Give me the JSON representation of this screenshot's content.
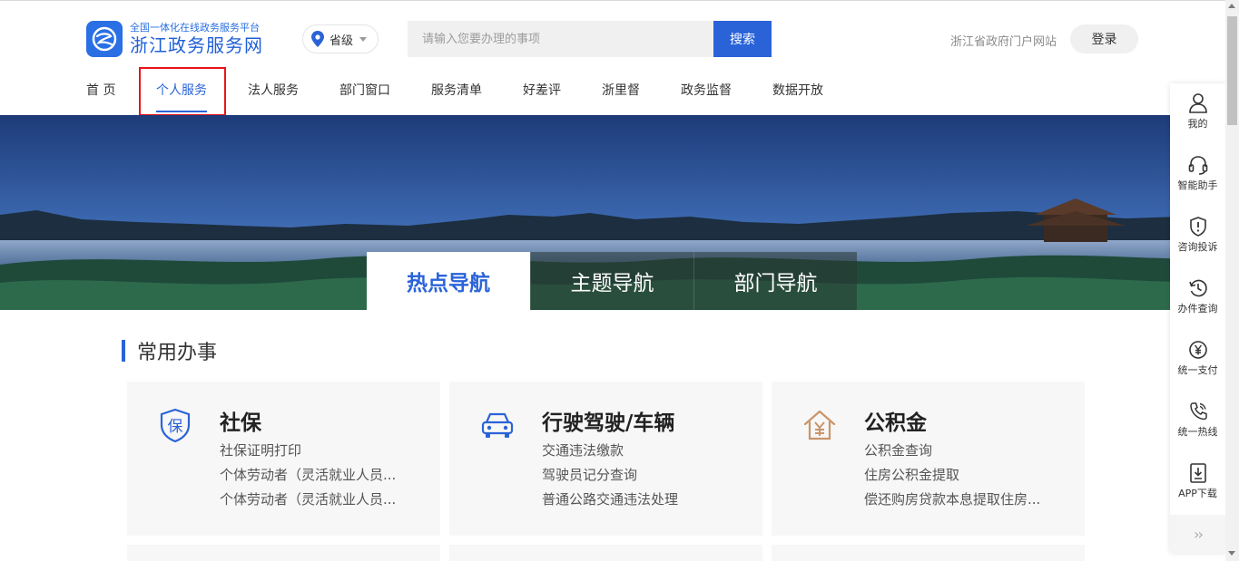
{
  "header": {
    "logo_subtitle": "全国一体化在线政务服务平台",
    "logo_title": "浙江政务服务网",
    "region_label": "省级",
    "search_placeholder": "请输入您要办理的事项",
    "search_button": "搜索",
    "gov_portal_link": "浙江省政府门户网站",
    "login_button": "登录"
  },
  "nav": {
    "items": [
      "首 页",
      "个人服务",
      "法人服务",
      "部门窗口",
      "服务清单",
      "好差评",
      "浙里督",
      "政务监督",
      "数据开放"
    ],
    "active": "个人服务"
  },
  "banner": {
    "tabs": [
      "热点导航",
      "主题导航",
      "部门导航"
    ],
    "active_tab": "热点导航"
  },
  "section": {
    "title": "常用办事"
  },
  "cards": [
    {
      "icon": "shield-bao-icon",
      "title": "社保",
      "links": [
        "社保证明打印",
        "个体劳动者（灵活就业人员...",
        "个体劳动者（灵活就业人员..."
      ]
    },
    {
      "icon": "car-icon",
      "title": "行驶驾驶/车辆",
      "links": [
        "交通违法缴款",
        "驾驶员记分查询",
        "普通公路交通违法处理"
      ]
    },
    {
      "icon": "house-yen-icon",
      "title": "公积金",
      "links": [
        "公积金查询",
        "住房公积金提取",
        "偿还购房贷款本息提取住房..."
      ]
    }
  ],
  "sidebar": {
    "items": [
      {
        "icon": "user-icon",
        "label": "我的"
      },
      {
        "icon": "headset-icon",
        "label": "智能助手"
      },
      {
        "icon": "shield-alert-icon",
        "label": "咨询投诉"
      },
      {
        "icon": "history-icon",
        "label": "办件查询"
      },
      {
        "icon": "yen-circle-icon",
        "label": "统一支付"
      },
      {
        "icon": "phone-icon",
        "label": "统一热线"
      },
      {
        "icon": "download-icon",
        "label": "APP下载"
      }
    ],
    "more_label": "››"
  },
  "colors": {
    "brand_blue": "#2a63d8",
    "highlight_red": "#e8141a",
    "card_bg": "#f7f7f7"
  }
}
